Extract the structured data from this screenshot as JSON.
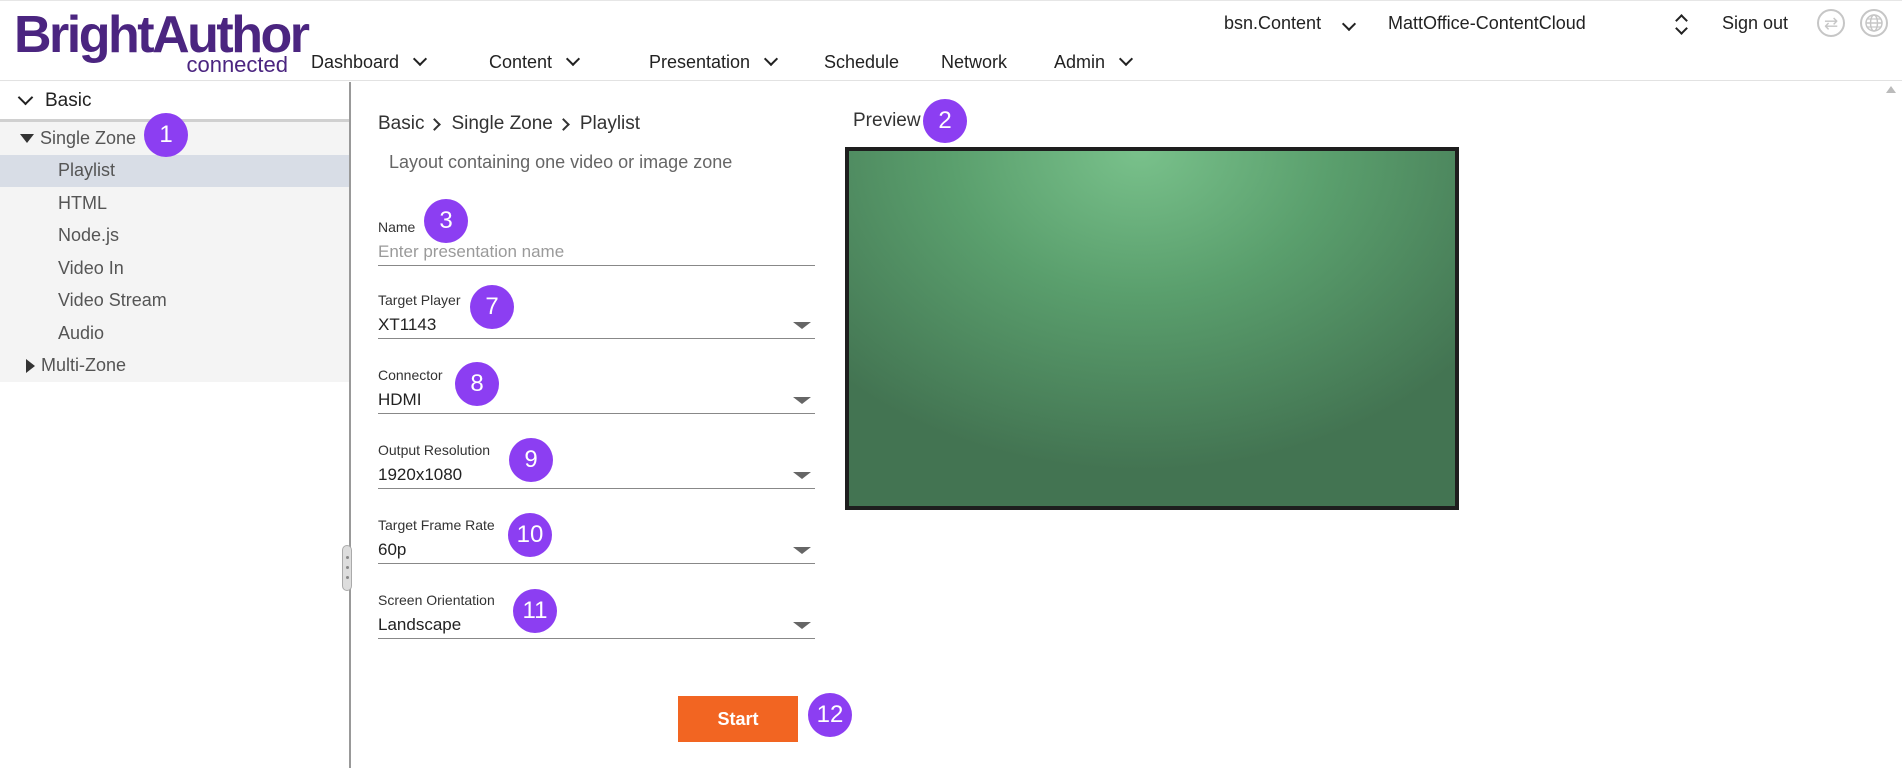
{
  "header": {
    "logo_main": "BrightAuthor",
    "logo_sub": "connected",
    "nav": [
      {
        "label": "Dashboard",
        "has_dropdown": true
      },
      {
        "label": "Content",
        "has_dropdown": true
      },
      {
        "label": "Presentation",
        "has_dropdown": true
      },
      {
        "label": "Schedule",
        "has_dropdown": false
      },
      {
        "label": "Network",
        "has_dropdown": false
      },
      {
        "label": "Admin",
        "has_dropdown": true
      }
    ],
    "content_source": "bsn.Content",
    "network_name": "MattOffice-ContentCloud",
    "sign_out": "Sign out",
    "icons": [
      "sync-icon",
      "globe-icon"
    ]
  },
  "sidebar": {
    "section": "Basic",
    "groups": [
      {
        "label": "Single Zone",
        "expanded": true,
        "items": [
          {
            "label": "Playlist",
            "selected": true
          },
          {
            "label": "HTML",
            "selected": false
          },
          {
            "label": "Node.js",
            "selected": false
          },
          {
            "label": "Video In",
            "selected": false
          },
          {
            "label": "Video Stream",
            "selected": false
          },
          {
            "label": "Audio",
            "selected": false
          }
        ]
      },
      {
        "label": "Multi-Zone",
        "expanded": false,
        "items": []
      }
    ]
  },
  "form": {
    "breadcrumb": [
      "Basic",
      "Single Zone",
      "Playlist"
    ],
    "description": "Layout containing one video or image zone",
    "name": {
      "label": "Name",
      "value": "",
      "placeholder": "Enter presentation name"
    },
    "target_player": {
      "label": "Target Player",
      "value": "XT1143"
    },
    "connector": {
      "label": "Connector",
      "value": "HDMI"
    },
    "output_resolution": {
      "label": "Output Resolution",
      "value": "1920x1080"
    },
    "target_frame_rate": {
      "label": "Target Frame Rate",
      "value": "60p"
    },
    "screen_orientation": {
      "label": "Screen Orientation",
      "value": "Landscape"
    },
    "start_label": "Start"
  },
  "preview": {
    "label": "Preview"
  },
  "badges": {
    "single_zone": "1",
    "preview": "2",
    "name": "3",
    "target_player": "7",
    "connector": "8",
    "output_resolution": "9",
    "target_frame_rate": "10",
    "screen_orientation": "11",
    "start": "12"
  },
  "colors": {
    "brand_purple": "#4b2580",
    "badge_purple": "#8c3ef2",
    "start_orange": "#f26522",
    "preview_green": "#5a9f6d"
  }
}
